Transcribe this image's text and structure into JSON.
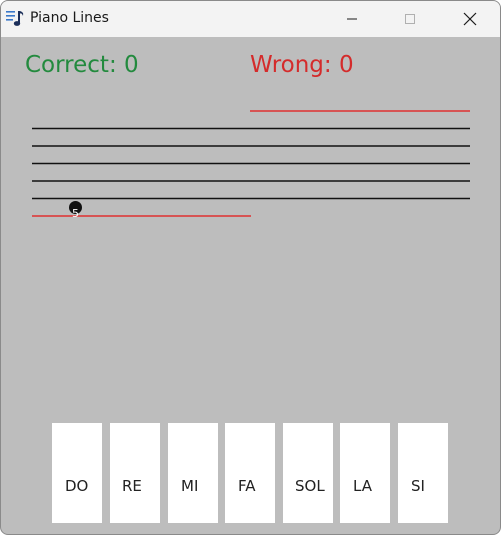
{
  "window": {
    "title": "Piano Lines",
    "app_icon": "music-note-icon",
    "controls": [
      "minimize-icon",
      "maximize-icon",
      "close-icon"
    ]
  },
  "score": {
    "correct": "Correct: 0",
    "wrong": "Wrong: 0"
  },
  "note": {
    "label": "5"
  },
  "keys": [
    {
      "label": "DO"
    },
    {
      "label": "RE"
    },
    {
      "label": "MI"
    },
    {
      "label": "FA"
    },
    {
      "label": "SOL"
    },
    {
      "label": "LA"
    },
    {
      "label": "SI"
    }
  ],
  "colors": {
    "background": "#bdbdbd",
    "correct": "#238a3e",
    "wrong": "#d42b2b",
    "ledger_line": "#e03030",
    "staff_line": "#111111",
    "key": "#ffffff"
  }
}
